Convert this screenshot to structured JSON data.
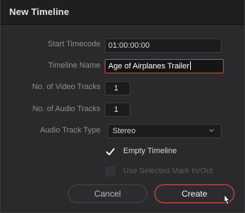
{
  "dialog": {
    "title": "New Timeline"
  },
  "fields": {
    "start_timecode": {
      "label": "Start Timecode",
      "value": "01:00:00:00"
    },
    "timeline_name": {
      "label": "Timeline Name",
      "value": "Age of Airplanes Trailer"
    },
    "video_tracks": {
      "label": "No. of Video Tracks",
      "value": "1"
    },
    "audio_tracks": {
      "label": "No. of Audio Tracks",
      "value": "1"
    },
    "audio_track_type": {
      "label": "Audio Track Type",
      "value": "Stereo"
    }
  },
  "options": {
    "empty_timeline": {
      "label": "Empty Timeline",
      "checked": true
    },
    "use_selected_mark": {
      "label": "Use Selected Mark In/Out",
      "checked": false,
      "enabled": false
    }
  },
  "buttons": {
    "cancel": "Cancel",
    "create": "Create"
  },
  "colors": {
    "accent": "#c84c48",
    "background": "#2a2a2c",
    "label": "#8e8e92"
  },
  "icons": {
    "dropdown": "chevron-down-icon",
    "check": "checkmark-icon",
    "cursor": "mouse-pointer-icon"
  }
}
